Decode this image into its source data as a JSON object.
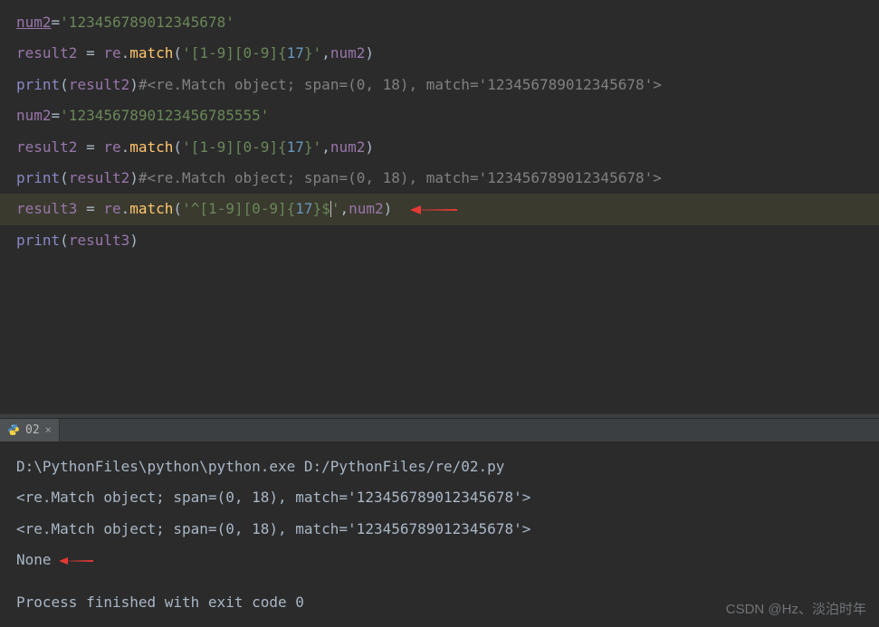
{
  "editor": {
    "lines": {
      "l1": {
        "var": "num2",
        "eq": "=",
        "str": "'123456789012345678'"
      },
      "l2": {
        "var": "result2",
        "eq": " = ",
        "obj": "re",
        "dot": ".",
        "fn": "match",
        "open": "(",
        "s1": "'[1-9][0-9]{",
        "n1": "17",
        "s2": "}'",
        "comma": ",",
        "arg": "num2",
        "close": ")"
      },
      "l3": {
        "fn": "print",
        "open": "(",
        "arg": "result2",
        "close": ")",
        "comment": "#<re.Match object; span=(0, 18), match='123456789012345678'>"
      },
      "l4": {
        "var": "num2",
        "eq": "=",
        "str": "'1234567890123456785555'"
      },
      "l5": {
        "var": "result2",
        "eq": " = ",
        "obj": "re",
        "dot": ".",
        "fn": "match",
        "open": "(",
        "s1": "'[1-9][0-9]{",
        "n1": "17",
        "s2": "}'",
        "comma": ",",
        "arg": "num2",
        "close": ")"
      },
      "l6": {
        "fn": "print",
        "open": "(",
        "arg": "result2",
        "close": ")",
        "comment": "#<re.Match object; span=(0, 18), match='123456789012345678'>"
      },
      "l7": {
        "var": "result3",
        "eq": " = ",
        "obj": "re",
        "dot": ".",
        "fn": "match",
        "open": "(",
        "s1": "'^[1-9][0-9]{",
        "n1": "17",
        "s2": "}$",
        "s3": "'",
        "comma": ",",
        "arg": "num2",
        "close": ")"
      },
      "l8": {
        "fn": "print",
        "open": "(",
        "arg": "result3",
        "close": ")"
      }
    }
  },
  "tab": {
    "label": "02"
  },
  "console": {
    "c1": "D:\\PythonFiles\\python\\python.exe D:/PythonFiles/re/02.py",
    "c2": "<re.Match object; span=(0, 18), match='123456789012345678'>",
    "c3": "<re.Match object; span=(0, 18), match='123456789012345678'>",
    "c4": "None",
    "c5": "",
    "c6": "Process finished with exit code 0"
  },
  "watermark": "CSDN @Hz、淡泊时年"
}
